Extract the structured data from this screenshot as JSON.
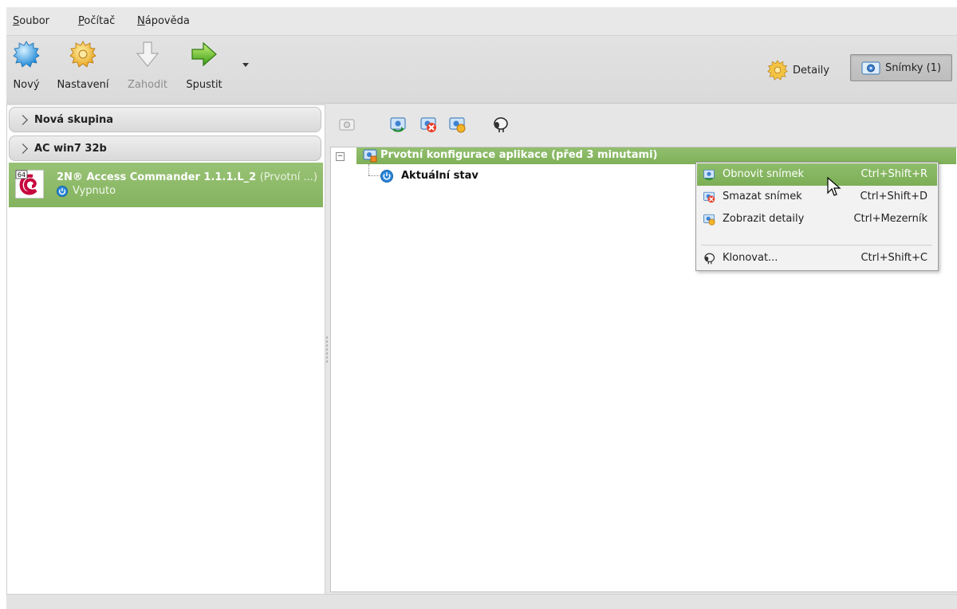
{
  "menubar": {
    "items": [
      {
        "label": "Soubor"
      },
      {
        "label": "Počítač"
      },
      {
        "label": "Nápověda"
      }
    ]
  },
  "toolbar": {
    "new_label": "Nový",
    "settings_label": "Nastavení",
    "discard_label": "Zahodit",
    "start_label": "Spustit",
    "details_label": "Detaily",
    "snapshots_label": "Snímky (1)"
  },
  "groups": [
    {
      "label": "Nová skupina"
    },
    {
      "label": "AC win7 32b"
    }
  ],
  "vm": {
    "name": "2N® Access Commander 1.1.1.L_2",
    "snapshot_state": "(Prvotní ...)",
    "status": "Vypnuto",
    "arch_badge": "64"
  },
  "snapshot_tree": {
    "root_label": "Prvotní konfigurace aplikace (před 3 minutami)",
    "current_label": "Aktuální stav"
  },
  "context_menu": {
    "items": [
      {
        "label": "Obnovit snímek",
        "shortcut": "Ctrl+Shift+R"
      },
      {
        "label": "Smazat snímek",
        "shortcut": "Ctrl+Shift+D"
      },
      {
        "label": "Zobrazit detaily",
        "shortcut": "Ctrl+Mezerník"
      },
      {
        "label": "Klonovat...",
        "shortcut": "Ctrl+Shift+C"
      }
    ]
  },
  "colors": {
    "selection_green": "#8ab966",
    "window_bg": "#e6e6e6"
  }
}
